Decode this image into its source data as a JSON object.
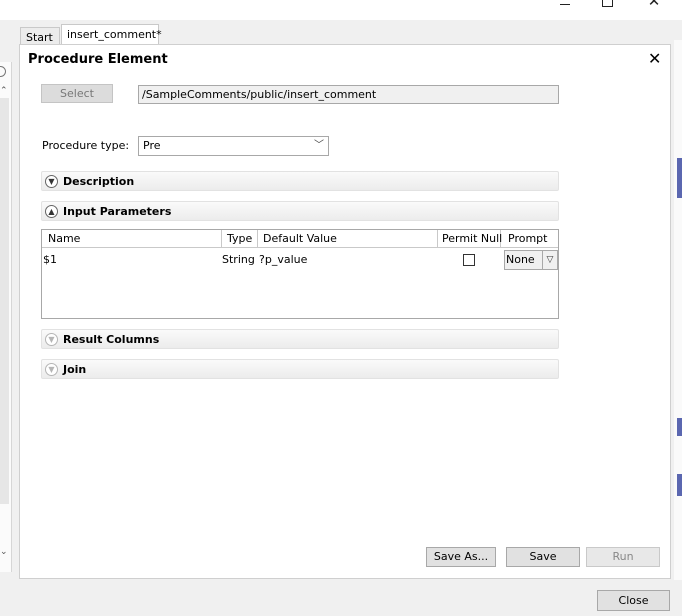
{
  "tabs": [
    {
      "label": "Start"
    },
    {
      "label": "insert_comment*"
    }
  ],
  "editor": {
    "title": "Procedure Element",
    "close_glyph": "✕",
    "select_label": "Select",
    "path_value": "/SampleComments/public/insert_comment",
    "procedure_type_label": "Procedure type:",
    "procedure_type_value": "Pre"
  },
  "sections": {
    "description": "Description",
    "input_parameters": "Input Parameters",
    "result_columns": "Result Columns",
    "join": "Join"
  },
  "params_table": {
    "headers": [
      "Name",
      "Type",
      "Default Value",
      "Permit Null",
      "Prompt"
    ],
    "rows": [
      {
        "name": "$1",
        "type": "String",
        "default": "?p_value",
        "permit_null": false,
        "prompt": "None"
      }
    ]
  },
  "buttons": {
    "save_as": "Save As...",
    "save": "Save",
    "run": "Run",
    "close": "Close"
  },
  "icons": {
    "expand": "chevron-down-circle",
    "collapse": "chevron-up-circle"
  }
}
